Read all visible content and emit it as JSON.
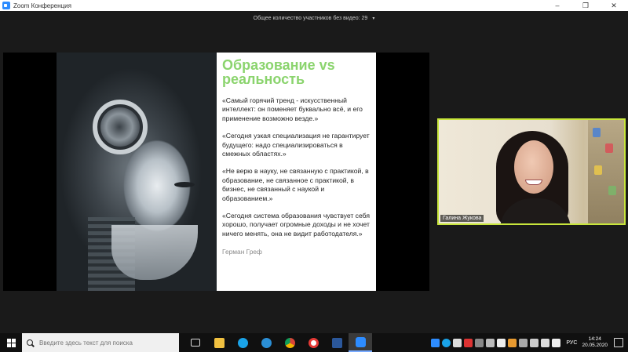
{
  "window": {
    "title": "Zoom Конференция",
    "controls": {
      "minimize": "–",
      "restore": "❐",
      "close": "✕"
    }
  },
  "meeting_bar": {
    "info": "Общее количество участников без видео: 29",
    "caret": "▾"
  },
  "slide": {
    "title": "Образование vs реальность",
    "quotes": [
      "«Самый горячий тренд - искусственный интеллект: он поменяет буквально всё, и его применение возможно везде.»",
      "«Сегодня узкая специализация не гарантирует будущего: надо специализироваться в смежных областях.»",
      "«Не верю в науку, не связанную с практикой, в образование, не связанное с практикой, в бизнес, не связанный с наукой и образованием.»",
      "«Сегодня система образования чувствует себя хорошо, получает огромные доходы и не хочет ничего менять, она не видит работодателя.»"
    ],
    "author": "Герман Греф",
    "title_color": "#8bd46e"
  },
  "participant": {
    "name": "Галина Жукова",
    "border_color": "#c8e63c"
  },
  "taskbar": {
    "search_placeholder": "Введите здесь текст для поиска",
    "language": "РУС",
    "time": "14:24",
    "date": "20.05.2020"
  }
}
